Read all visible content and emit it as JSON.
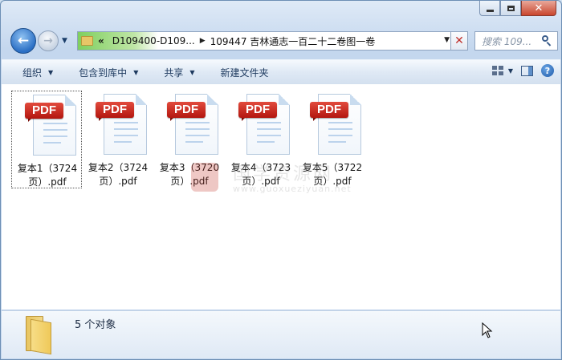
{
  "window": {
    "controls": [
      "minimize-icon",
      "maximize-icon",
      "close-icon"
    ],
    "close_glyph": "✕"
  },
  "nav": {
    "back_glyph": "←",
    "forward_glyph": "→",
    "address": {
      "overflow": "«",
      "segments": [
        "D109400-D109...",
        "109447 吉林通志一百二十二卷图一卷"
      ]
    },
    "search_placeholder": "搜索 109...",
    "refresh_glyph": "✕"
  },
  "toolbar": {
    "organize": "组织",
    "include_in_library": "包含到库中",
    "share": "共享",
    "new_folder": "新建文件夹"
  },
  "files": [
    {
      "label": "PDF",
      "name_line1": "复本1（3724",
      "name_line2": "页）.pdf",
      "selected": true
    },
    {
      "label": "PDF",
      "name_line1": "复本2（3724",
      "name_line2": "页）.pdf",
      "selected": false
    },
    {
      "label": "PDF",
      "name_line1": "复本3（3720",
      "name_line2": "页）.pdf",
      "selected": false
    },
    {
      "label": "PDF",
      "name_line1": "复本4（3723",
      "name_line2": "页）.pdf",
      "selected": false
    },
    {
      "label": "PDF",
      "name_line1": "复本5（3722",
      "name_line2": "页）.pdf",
      "selected": false
    }
  ],
  "watermark": {
    "text": "国学资源网",
    "url": "www.guoxueziyuan.net"
  },
  "details": {
    "count_text": "5 个对象"
  },
  "colors": {
    "address_progress": "#7fcf5f",
    "pdf_badge": "#d12f23",
    "accent_blue": "#2b6fc4"
  }
}
